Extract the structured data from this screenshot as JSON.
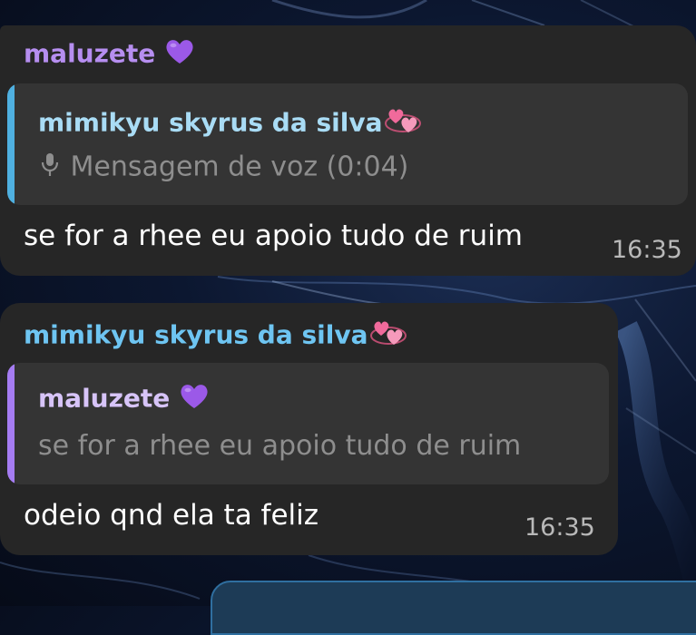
{
  "messages": [
    {
      "sender": "maluzete",
      "sender_emoji_icon": "purple-heart-icon",
      "reply_to": {
        "author": "mimikyu skyrus da silva",
        "author_emoji_icon": "revolving-hearts-icon",
        "content_icon": "microphone-icon",
        "content": "Mensagem de voz (0:04)"
      },
      "text": "se for a rhee eu apoio tudo de ruim",
      "time": "16:35"
    },
    {
      "sender": "mimikyu skyrus da silva",
      "sender_emoji_icon": "revolving-hearts-icon",
      "reply_to": {
        "author": "maluzete",
        "author_emoji_icon": "purple-heart-icon",
        "content": "se for a rhee eu apoio tudo de ruim"
      },
      "text": "odeio qnd ela ta feliz",
      "time": "16:35"
    }
  ],
  "colors": {
    "bubble_bg": "#262626",
    "quote_bg": "#343434",
    "sender_purple": "#b68ef0",
    "sender_blue": "#6ec5f2",
    "quote_bar_blue": "#4fb0e0",
    "quote_bar_purple": "#a57cf2"
  }
}
